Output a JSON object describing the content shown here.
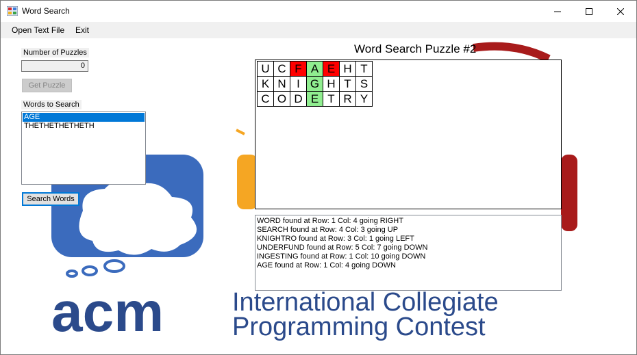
{
  "window": {
    "title": "Word Search"
  },
  "menu": {
    "open_label": "Open Text File",
    "exit_label": "Exit"
  },
  "left_panel": {
    "num_puzzles_label": "Number of Puzzles",
    "num_puzzles_value": "0",
    "get_puzzle_label": "Get Puzzle",
    "words_label": "Words to Search",
    "words": [
      "AGE",
      "THETHETHETHETH"
    ],
    "selected_word_index": 0,
    "search_button_label": "Search Words"
  },
  "puzzle": {
    "title": "Word Search Puzzle #2",
    "grid": [
      [
        "U",
        "C",
        "F",
        "A",
        "E",
        "H",
        "T"
      ],
      [
        "K",
        "N",
        "I",
        "G",
        "H",
        "T",
        "S"
      ],
      [
        "C",
        "O",
        "D",
        "E",
        "T",
        "R",
        "Y"
      ]
    ],
    "highlights": [
      [
        "",
        "",
        "red",
        "green",
        "red",
        "",
        ""
      ],
      [
        "",
        "",
        "",
        "green",
        "",
        "",
        ""
      ],
      [
        "",
        "",
        "",
        "green",
        "",
        "",
        ""
      ]
    ]
  },
  "results": [
    "WORD found at Row: 1 Col: 4 going RIGHT",
    "SEARCH found at Row: 4 Col: 3 going UP",
    "KNIGHTRO found at Row: 3 Col: 1 going LEFT",
    "UNDERFUND found at Row: 5 Col: 7 going DOWN",
    "INGESTING found at Row: 1 Col: 10 going DOWN",
    "AGE found at Row: 1 Col: 4 going DOWN"
  ],
  "background": {
    "acm_text": "acm",
    "line1": "International Collegiate",
    "line2": "Programming Contest"
  },
  "colors": {
    "acm_blue": "#2b4a8b",
    "cloud_blue": "#3b6bbd",
    "icpc_yellow": "#f5a623",
    "icpc_red": "#a81b1b",
    "selection": "#0078d7",
    "highlight_red": "#ff0000",
    "highlight_green": "#90ee90"
  }
}
